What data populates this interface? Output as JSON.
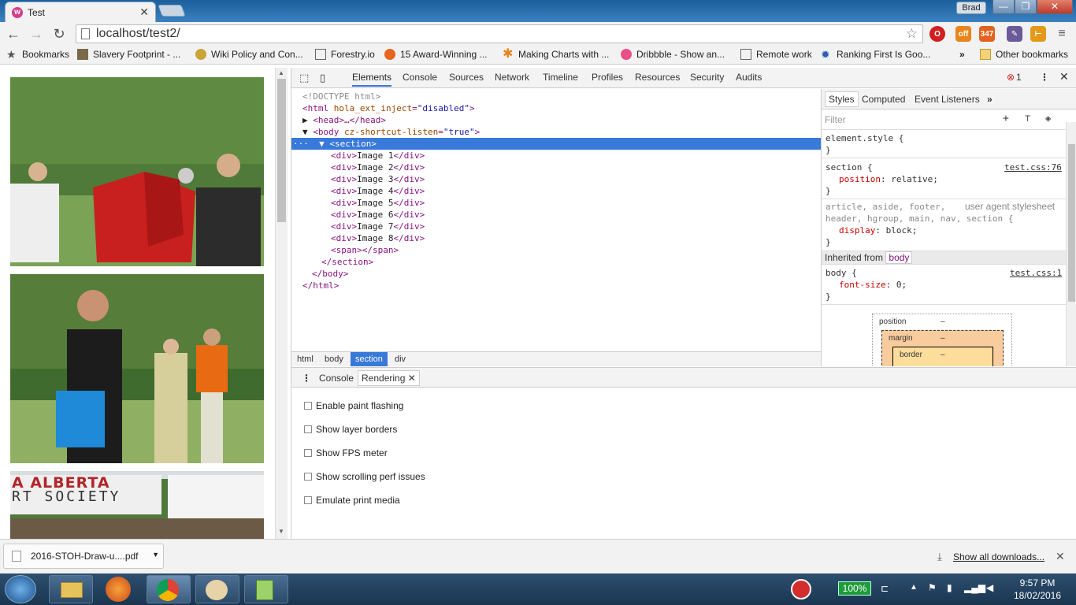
{
  "window": {
    "tab_title": "Test",
    "tab_favicon": "w",
    "user": "Brad",
    "controls": {
      "minimize": "—",
      "maximize": "❐",
      "close": "✕"
    }
  },
  "toolbar": {
    "url": "localhost/test2/",
    "ext_badges": {
      "off": "off",
      "rss": "347"
    }
  },
  "bookmarks": {
    "label": "Bookmarks",
    "items": [
      "Slavery Footprint - ...",
      "Wiki Policy and Con...",
      "Forestry.io",
      "15 Award-Winning ...",
      "Making Charts with ...",
      "Dribbble - Show an...",
      "Remote work",
      "Ranking First Is Goo..."
    ],
    "overflow": "»",
    "other": "Other bookmarks"
  },
  "devtools": {
    "tabs": [
      "Elements",
      "Console",
      "Sources",
      "Network",
      "Timeline",
      "Profiles",
      "Resources",
      "Security",
      "Audits"
    ],
    "error_count": "1",
    "dom": {
      "doctype": "<!DOCTYPE html>",
      "html_open": "<html",
      "html_attr": "hola_ext_inject",
      "html_val": "\"disabled\"",
      "head": "<head>…</head>",
      "body_open": "<body",
      "body_attr": "cz-shortcut-listen",
      "body_val": "\"true\"",
      "section": "<section>",
      "divs": [
        "Image 1",
        "Image 2",
        "Image 3",
        "Image 4",
        "Image 5",
        "Image 6",
        "Image 7",
        "Image 8"
      ],
      "span": "<span></span>",
      "section_close": "</section>",
      "body_close": "</body>",
      "html_close": "</html>"
    },
    "breadcrumbs": [
      "html",
      "body",
      "section",
      "div"
    ],
    "styles_tabs": [
      "Styles",
      "Computed",
      "Event Listeners"
    ],
    "filter_placeholder": "Filter",
    "rules": {
      "element_style": "element.style {",
      "section_selector": "section {",
      "section_link": "test.css:76",
      "section_prop": "position",
      "section_val": "relative;",
      "ua_selector_1": "article, aside, footer,",
      "ua_label": "user agent stylesheet",
      "ua_selector_2": "header, hgroup, main, nav, section {",
      "ua_prop": "display",
      "ua_val": "block;",
      "inherited_label": "Inherited from",
      "inherited_tag": "body",
      "body_selector": "body {",
      "body_link": "test.css:1",
      "body_prop": "font-size",
      "body_val": "0;",
      "close": "}"
    },
    "boxmodel": {
      "position": "position",
      "margin": "margin",
      "border": "border",
      "dash": "–"
    },
    "drawer_tabs": [
      "Console",
      "Rendering"
    ],
    "rendering_options": [
      "Enable paint flashing",
      "Show layer borders",
      "Show FPS meter",
      "Show scrolling perf issues",
      "Emulate print media"
    ]
  },
  "downloads": {
    "file": "2016-STOH-Draw-u....pdf",
    "show_all": "Show all downloads...",
    "close": "✕"
  },
  "taskbar": {
    "battery": "100%",
    "time": "9:57 PM",
    "date": "18/02/2016"
  },
  "page": {
    "banner_text_1": "A ALBERTA",
    "banner_text_2": "RT SOCIETY"
  }
}
